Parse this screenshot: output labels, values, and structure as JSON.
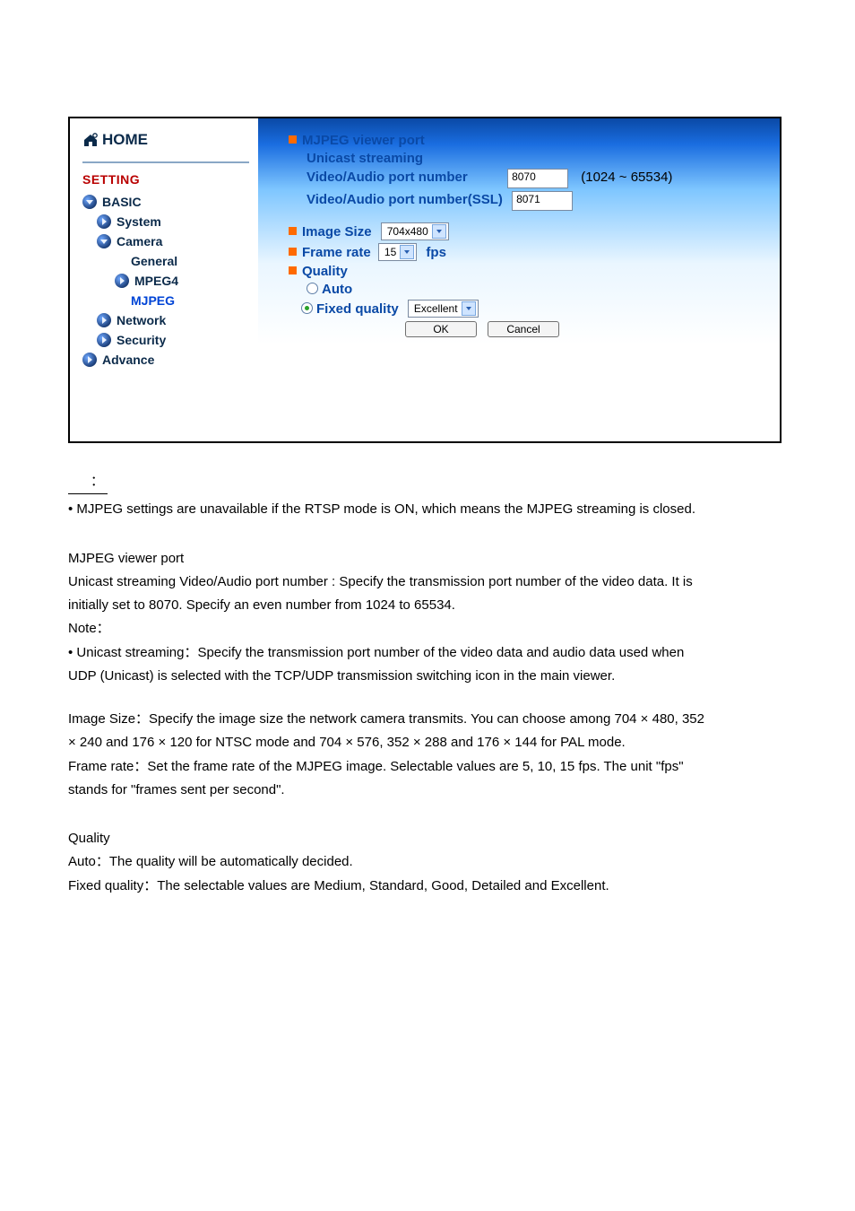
{
  "sidebar": {
    "home": "HOME",
    "setting": "SETTING",
    "items": [
      {
        "label": "BASIC"
      },
      {
        "label": "System"
      },
      {
        "label": "Camera"
      },
      {
        "label": "General"
      },
      {
        "label": "MPEG4"
      },
      {
        "label": "MJPEG"
      },
      {
        "label": "Network"
      },
      {
        "label": "Security"
      },
      {
        "label": "Advance"
      }
    ]
  },
  "panel": {
    "title": "MJPEG viewer port",
    "unicast_heading": "Unicast streaming",
    "port_label": "Video/Audio port number",
    "port_value": "8070",
    "port_range": "(1024 ~ 65534)",
    "port_ssl_label": "Video/Audio port number(SSL)",
    "port_ssl_value": "8071",
    "image_size_label": "Image Size",
    "image_size_value": "704x480",
    "frame_rate_label_pre": "Frame rate",
    "frame_rate_value": "15",
    "frame_rate_label_post": "fps",
    "quality_label": "Quality",
    "auto_label": "Auto",
    "fixed_label": "Fixed quality",
    "fixed_value": "Excellent",
    "ok": "OK",
    "cancel": "Cancel"
  },
  "doc": {
    "colon": "：",
    "line1": "• MJPEG settings are unavailable if the RTSP mode is ON, which means the MJPEG streaming is closed.",
    "h1": "MJPEG viewer port",
    "p1a": "Unicast streaming Video/Audio port number : Specify the transmission port number of the video data. It is",
    "p1b": "initially set to 8070. Specify an even number from 1024 to 65534.",
    "note": "Note：",
    "p2a": "• Unicast streaming：Specify the transmission port number of the video data and audio data used when",
    "p2b": "UDP (Unicast) is selected with the TCP/UDP transmission switching icon in the main viewer.",
    "p3a": "Image Size：Specify the image size the network camera transmits. You can choose among 704 × 480, 352",
    "p3b": "× 240 and 176 × 120 for NTSC mode and 704 × 576, 352 × 288 and 176 × 144 for PAL mode.",
    "p4a": "Frame rate：Set the frame rate of the MJPEG image. Selectable values are 5, 10, 15 fps. The unit \"fps\"",
    "p4b": "stands for \"frames sent per second\".",
    "h2": "Quality",
    "p5": "Auto：The quality will be automatically decided.",
    "p6": "Fixed quality：The selectable values are Medium, Standard, Good, Detailed and Excellent."
  }
}
